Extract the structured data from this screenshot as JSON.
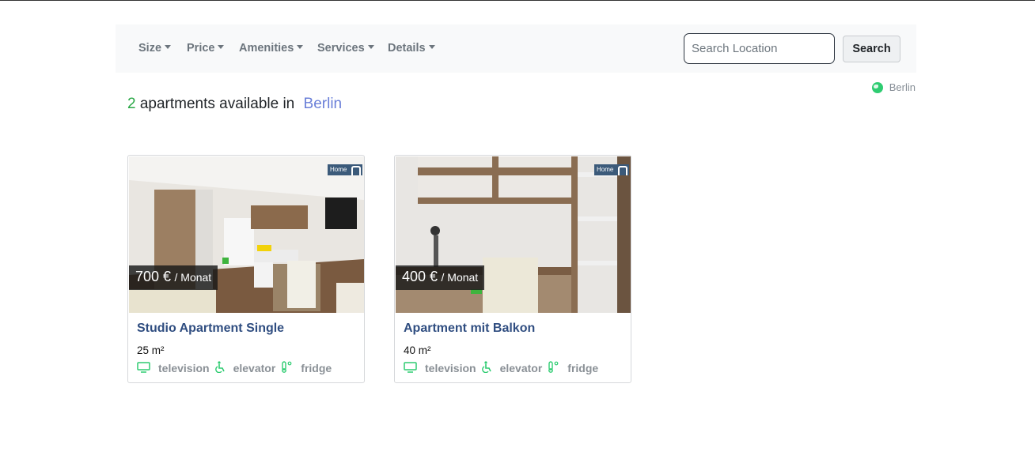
{
  "nav": {
    "items": [
      {
        "label": "Size"
      },
      {
        "label": "Price"
      },
      {
        "label": "Amenities"
      },
      {
        "label": "Services"
      },
      {
        "label": "Details"
      }
    ],
    "search_placeholder": "Search Location",
    "search_button": "Search"
  },
  "location_badge": {
    "icon": "globe-icon",
    "text": "Berlin"
  },
  "heading": {
    "count": "2",
    "text": "apartments available in",
    "city": "Berlin"
  },
  "listings": [
    {
      "price": "700 €",
      "per": "/ Monat",
      "title": "Studio Apartment Single",
      "size": "25 m²",
      "logo": "Home",
      "amenities": [
        {
          "icon": "television-icon",
          "label": "television"
        },
        {
          "icon": "elevator-icon",
          "label": "elevator"
        },
        {
          "icon": "fridge-icon",
          "label": "fridge"
        }
      ]
    },
    {
      "price": "400 €",
      "per": "/ Monat",
      "title": "Apartment mit Balkon",
      "size": "40 m²",
      "logo": "Home",
      "amenities": [
        {
          "icon": "television-icon",
          "label": "television"
        },
        {
          "icon": "elevator-icon",
          "label": "elevator"
        },
        {
          "icon": "fridge-icon",
          "label": "fridge"
        }
      ]
    }
  ],
  "colors": {
    "accent_green": "#28a745",
    "city_link": "#6a7fd8",
    "title_blue": "#2f4d80",
    "icon_green": "#2ecc71"
  }
}
